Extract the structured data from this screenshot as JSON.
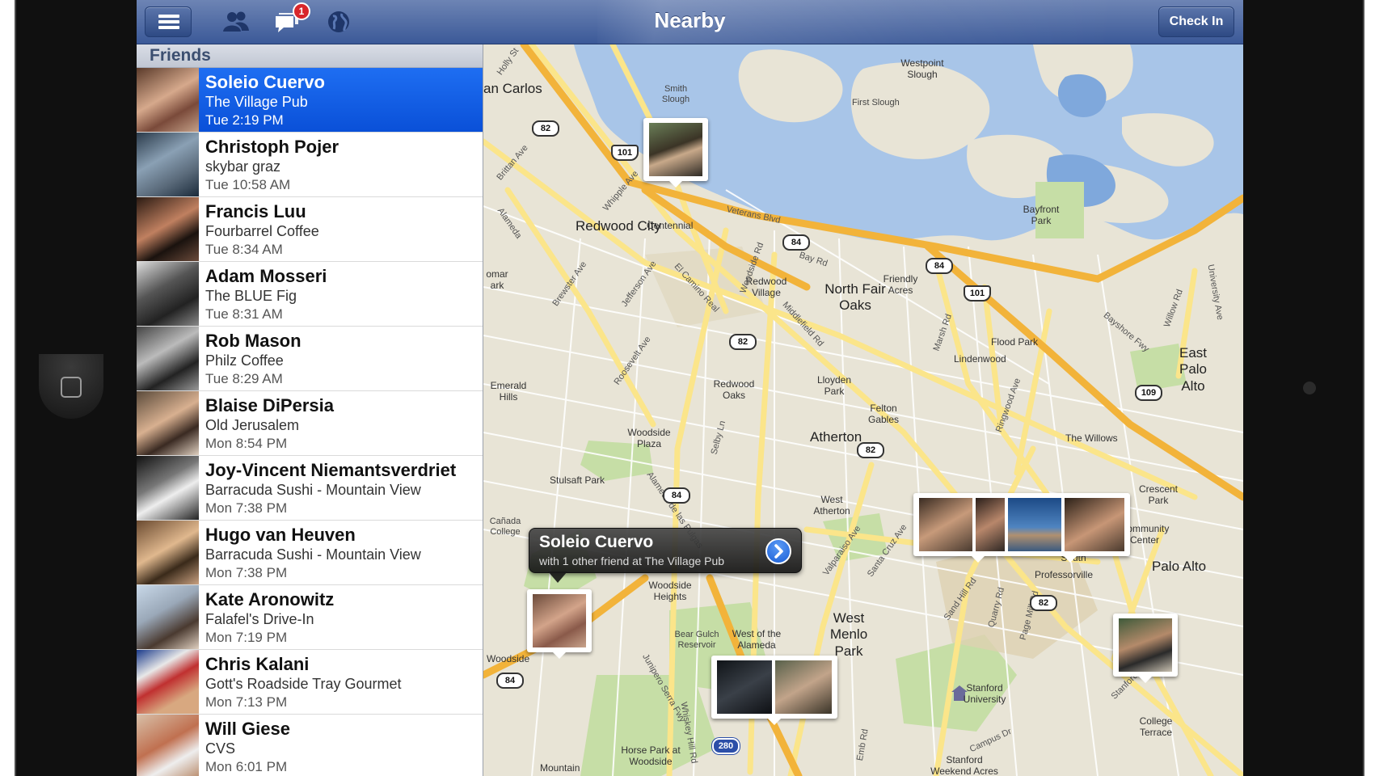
{
  "header": {
    "title": "Nearby",
    "check_in_label": "Check In",
    "notification_count": "1"
  },
  "sidebar": {
    "section_title": "Friends",
    "friends": [
      {
        "name": "Soleio Cuervo",
        "place": "The Village Pub",
        "time": "Tue 2:19 PM"
      },
      {
        "name": "Christoph Pojer",
        "place": "skybar graz",
        "time": "Tue 10:58 AM"
      },
      {
        "name": "Francis Luu",
        "place": "Fourbarrel Coffee",
        "time": "Tue 8:34 AM"
      },
      {
        "name": "Adam Mosseri",
        "place": "The BLUE Fig",
        "time": "Tue 8:31 AM"
      },
      {
        "name": "Rob Mason",
        "place": "Philz Coffee",
        "time": "Tue 8:29 AM"
      },
      {
        "name": "Blaise DiPersia",
        "place": "Old Jerusalem",
        "time": "Mon 8:54 PM"
      },
      {
        "name": "Joy-Vincent Niemantsverdriet",
        "place": "Barracuda Sushi - Mountain View",
        "time": "Mon 7:38 PM"
      },
      {
        "name": "Hugo van Heuven",
        "place": "Barracuda Sushi - Mountain View",
        "time": "Mon 7:38 PM"
      },
      {
        "name": "Kate Aronowitz",
        "place": "Falafel's Drive-In",
        "time": "Mon 7:19 PM"
      },
      {
        "name": "Chris Kalani",
        "place": "Gott's Roadside Tray Gourmet",
        "time": "Mon 7:13 PM"
      },
      {
        "name": "Will Giese",
        "place": "CVS",
        "time": "Mon 6:01 PM"
      }
    ]
  },
  "callout": {
    "name": "Soleio Cuervo",
    "detail": "with 1 other friend at The Village Pub"
  },
  "map": {
    "cities": [
      "Redwood City",
      "North Fair Oaks",
      "Atherton",
      "East Palo Alto",
      "Palo Alto",
      "West Menlo Park",
      "an Carlos"
    ],
    "places": [
      "Westpoint Slough",
      "Smith Slough",
      "First Slough",
      "Bayfront Park",
      "Centennial",
      "Redwood Village",
      "Friendly Acres",
      "Flood Park",
      "Lindenwood",
      "Redwood Oaks",
      "Lloyden Park",
      "Felton Gables",
      "Woodside Plaza",
      "Stulsaft Park",
      "West Atherton",
      "Emerald Hills",
      "Cañada College",
      "Woodside Heights",
      "Bear Gulch Reservoir",
      "West of the Alameda",
      "Woodside",
      "Horse Park at Woodside",
      "Stanford University",
      "Stanford Weekend Acres",
      "University South",
      "Professorville",
      "Community Center",
      "Crescent Park",
      "The Willows",
      "College Terrace",
      "Mountain",
      "omar ark"
    ],
    "roads": [
      "Veterans Blvd",
      "Bay Rd",
      "El Camino Real",
      "Middlefield Rd",
      "Woodside Rd",
      "Whipple Ave",
      "Brewster Ave",
      "Jefferson Ave",
      "Alameda",
      "Roosevelt Ave",
      "Bayshore Fwy",
      "Willow Rd",
      "Marsh Rd",
      "Ringwood Ave",
      "Santa Cruz Ave",
      "Valparaiso Ave",
      "Sand Hill Rd",
      "Junipero Serra Fwy",
      "Campus Dr",
      "Stanford Ave",
      "University Ave",
      "Selby Ln",
      "Alameda de las Pulgas",
      "Brittan Ave",
      "Holly St",
      "Quarry Rd",
      "Page Mill Rd",
      "Emb Rd",
      "Whiskey Hill Rd"
    ],
    "highway_shields": [
      "82",
      "101",
      "84",
      "84",
      "101",
      "82",
      "82",
      "84",
      "109",
      "82",
      "84",
      "280"
    ]
  },
  "colors": {
    "header": "#3b5998",
    "selected_row": "#1460e8",
    "water": "#a6c4e6",
    "land": "#e7e2d3",
    "highway": "#f2b63c",
    "arterial": "#fbe78a",
    "park": "#c5dea5"
  },
  "icons": [
    "menu-icon",
    "friends-icon",
    "notifications-icon",
    "globe-icon",
    "disclosure-arrow-icon",
    "school-icon"
  ]
}
